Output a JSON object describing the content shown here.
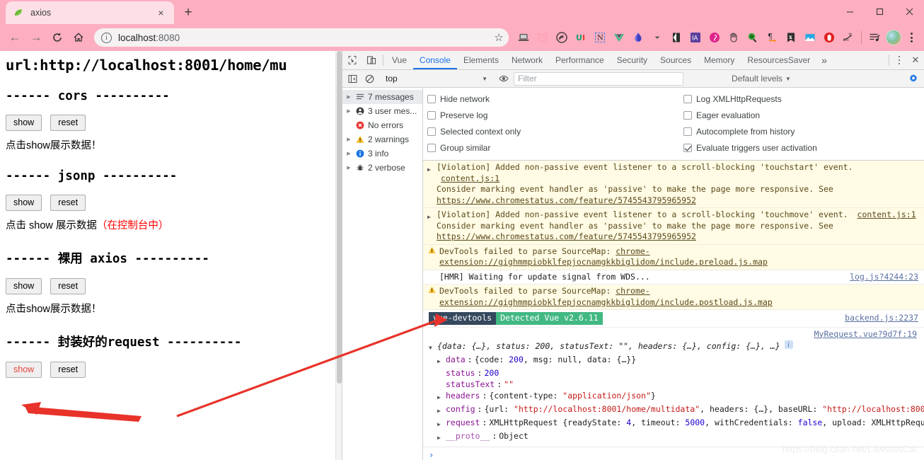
{
  "browser": {
    "tab": {
      "title": "axios",
      "favicon": "leaf-icon",
      "close_label": "×"
    },
    "newtab_label": "+",
    "window_controls": {
      "minimize": "—",
      "maximize": "□",
      "close": "✕"
    },
    "nav": {
      "back": "←",
      "forward": "→",
      "reload": "↻",
      "home": "⌂"
    },
    "omnibox": {
      "info_glyph": "i",
      "scheme": "localhost",
      "port": ":8080",
      "value": "localhost:8080",
      "bookmark_star": "☆"
    },
    "extensions": [
      "laptop-icon",
      "cat-icon",
      "stamp-icon",
      "ui-icon",
      "notion-icon",
      "vue-icon",
      "drop-icon",
      "chevron-down-icon",
      "bracket-icon",
      "ia-icon",
      "pink-circle-icon",
      "hand-icon",
      "magnifier-icon",
      "pilcrow-icon",
      "x-bookmark-icon",
      "image-icon",
      "opera-hand-icon",
      "en-translate-icon"
    ],
    "list_icon": "playlist-icon",
    "avatar": "user-avatar",
    "menu": "kebab-menu-icon"
  },
  "page": {
    "url_line": "url:http://localhost:8001/home/mu",
    "sections": [
      {
        "heading": "------ cors ----------",
        "buttons": [
          "show",
          "reset"
        ],
        "note": "点击 show 展示数据！",
        "note_plain": "点击show展示数据！",
        "note_red": ""
      },
      {
        "heading": "------ jsonp ----------",
        "buttons": [
          "show",
          "reset"
        ],
        "note_plain": "点击 show 展示数据",
        "note_red": "（在控制台中）"
      },
      {
        "heading": "------ 裸用 axios ----------",
        "buttons": [
          "show",
          "reset"
        ],
        "note_plain": "点击show展示数据！",
        "note_red": ""
      },
      {
        "heading": "------ 封装好的request ----------",
        "buttons": [
          "show",
          "reset"
        ],
        "note_plain": "",
        "note_red": ""
      }
    ],
    "button_labels": {
      "show": "show",
      "reset": "reset"
    }
  },
  "devtools": {
    "tabs": [
      {
        "label": "Vue",
        "active": false
      },
      {
        "label": "Console",
        "active": true
      },
      {
        "label": "Elements",
        "active": false
      },
      {
        "label": "Network",
        "active": false
      },
      {
        "label": "Performance",
        "active": false
      },
      {
        "label": "Security",
        "active": false
      },
      {
        "label": "Sources",
        "active": false
      },
      {
        "label": "Memory",
        "active": false
      },
      {
        "label": "ResourcesSaver",
        "active": false
      }
    ],
    "more_tabs": "»",
    "inspect_icon": "inspect-element-icon",
    "device_icon": "device-toolbar-icon",
    "kebab": "devtools-menu-icon",
    "close": "✕",
    "filterbar": {
      "sidebar_toggle_icon": "console-sidebar-toggle-icon",
      "clear_icon": "clear-console-icon",
      "context": "top",
      "eye_icon": "live-expression-icon",
      "filter_placeholder": "Filter",
      "filter_value": "",
      "levels": "Default levels",
      "gear_icon": "settings-gear-icon"
    },
    "sidebar": [
      {
        "label": "7 messages",
        "icon": "list-icon",
        "caret": true,
        "selected": true
      },
      {
        "label": "3 user mes...",
        "icon": "person-icon",
        "caret": true,
        "selected": false
      },
      {
        "label": "No errors",
        "icon": "error-icon",
        "caret": false,
        "selected": false
      },
      {
        "label": "2 warnings",
        "icon": "warning-icon",
        "caret": true,
        "selected": false
      },
      {
        "label": "3 info",
        "icon": "info-icon",
        "caret": true,
        "selected": false
      },
      {
        "label": "2 verbose",
        "icon": "bug-icon",
        "caret": true,
        "selected": false
      }
    ],
    "settings": [
      {
        "label": "Hide network",
        "checked": false
      },
      {
        "label": "Log XMLHttpRequests",
        "checked": false
      },
      {
        "label": "Preserve log",
        "checked": false
      },
      {
        "label": "Eager evaluation",
        "checked": false
      },
      {
        "label": "Selected context only",
        "checked": false
      },
      {
        "label": "Autocomplete from history",
        "checked": false
      },
      {
        "label": "Group similar",
        "checked": false
      },
      {
        "label": "Evaluate triggers user activation",
        "checked": true
      }
    ],
    "logs": [
      {
        "type": "violation",
        "text": "[Violation] Added non-passive event listener to a scroll-blocking 'touchstart' event.",
        "detail_pre": "Consider marking event handler as 'passive' to make the page more responsive. See ",
        "detail_link": "https://www.chromestatus.com/feature/5745543795965952",
        "source": "content.js:1"
      },
      {
        "type": "violation",
        "text": "[Violation] Added non-passive event listener to a scroll-blocking 'touchmove' event.",
        "detail_pre": "Consider marking event handler as 'passive' to make the page more responsive. See ",
        "detail_link": "https://www.chromestatus.com/feature/5745543795965952",
        "source": "content.js:1"
      },
      {
        "type": "warning",
        "text": "DevTools failed to parse SourceMap: ",
        "detail_link": "chrome-extension://gighmmpiobklfepjocnamgkkbiglidom/include.preload.js.map",
        "source": ""
      },
      {
        "type": "info",
        "text": "[HMR] Waiting for update signal from WDS...",
        "source": "log.js?4244:23"
      },
      {
        "type": "warning",
        "text": "DevTools failed to parse SourceMap: ",
        "detail_link": "chrome-extension://gighmmpiobklfepjocnamgkkbiglidom/include.postload.js.map",
        "source": ""
      }
    ],
    "vue_badge": {
      "left": "vue-devtools",
      "right": "Detected Vue v2.6.11",
      "source": "backend.js:2237"
    },
    "object_log": {
      "source": "MyRequest.vue?9d7f:19",
      "summary": "{data: {…}, status: 200, statusText: \"\", headers: {…}, config: {…}, …}",
      "rows": [
        {
          "key": "data",
          "value": "{code: 200, msg: null, data: {…}}",
          "expandable": true
        },
        {
          "key": "status",
          "value": "200",
          "expandable": false
        },
        {
          "key": "statusText",
          "value": "\"\"",
          "expandable": false
        },
        {
          "key": "headers",
          "value": "{content-type: \"application/json\"}",
          "expandable": true
        },
        {
          "key": "config",
          "value": "{url: \"http://localhost:8001/home/multidata\", headers: {…}, baseURL: \"http://localhost:800…",
          "expandable": true
        },
        {
          "key": "request",
          "value": "XMLHttpRequest {readyState: 4, timeout: 5000, withCredentials: false, upload: XMLHttpRequ…",
          "expandable": true
        },
        {
          "key": "__proto__",
          "value": "Object",
          "expandable": true
        }
      ]
    },
    "prompt_caret": "›"
  },
  "watermark": "https://blog.csdn.net/LawssssCat",
  "colors": {
    "chrome_pink": "#fdaec0",
    "tab_light": "#fde0e7",
    "accent_blue": "#1a73e8",
    "warn_bg": "#fffbe5",
    "arrow_red": "#e8332a",
    "vue_green": "#42b883",
    "vue_dark": "#35495e"
  }
}
